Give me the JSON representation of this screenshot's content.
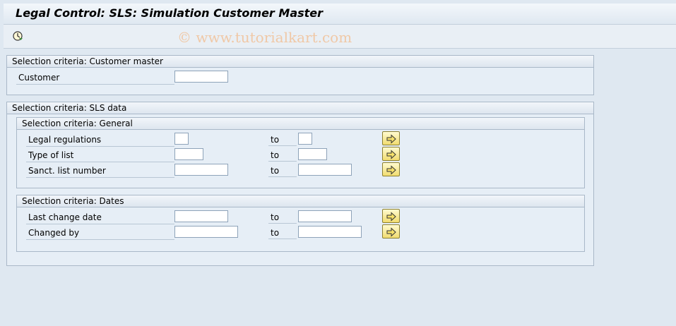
{
  "window": {
    "title": "Legal Control: SLS: Simulation Customer Master"
  },
  "toolbar": {
    "execute_icon": "execute-clock-icon",
    "watermark": "© www.tutorialkart.com"
  },
  "customer_master": {
    "title": "Selection criteria: Customer master",
    "fields": [
      {
        "label": "Customer",
        "value": ""
      }
    ]
  },
  "sls_data": {
    "title": "Selection criteria: SLS data",
    "general": {
      "title": "Selection criteria: General",
      "rows": [
        {
          "label": "Legal regulations",
          "from": "",
          "to_label": "to",
          "to": ""
        },
        {
          "label": "Type of list",
          "from": "",
          "to_label": "to",
          "to": ""
        },
        {
          "label": "Sanct. list number",
          "from": "",
          "to_label": "to",
          "to": ""
        }
      ]
    },
    "dates": {
      "title": "Selection criteria: Dates",
      "rows": [
        {
          "label": "Last change date",
          "from": "",
          "to_label": "to",
          "to": ""
        },
        {
          "label": "Changed by",
          "from": "",
          "to_label": "to",
          "to": ""
        }
      ]
    }
  },
  "multiple_selection_icon": "arrow-right-icon",
  "colors": {
    "background": "#dfe8f1",
    "button_yellow": "#f1dc70",
    "border": "#a9b8c8"
  }
}
